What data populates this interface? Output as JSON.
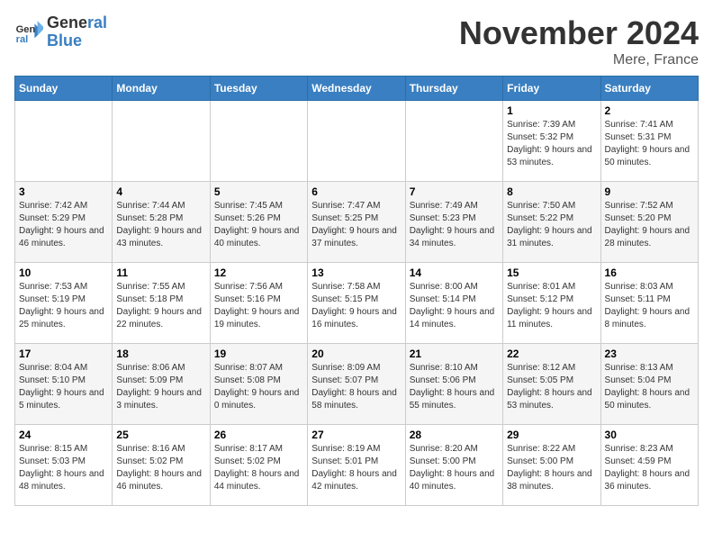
{
  "logo": {
    "line1": "General",
    "line2": "Blue"
  },
  "header": {
    "month": "November 2024",
    "location": "Mere, France"
  },
  "weekdays": [
    "Sunday",
    "Monday",
    "Tuesday",
    "Wednesday",
    "Thursday",
    "Friday",
    "Saturday"
  ],
  "weeks": [
    [
      {
        "day": "",
        "info": ""
      },
      {
        "day": "",
        "info": ""
      },
      {
        "day": "",
        "info": ""
      },
      {
        "day": "",
        "info": ""
      },
      {
        "day": "",
        "info": ""
      },
      {
        "day": "1",
        "info": "Sunrise: 7:39 AM\nSunset: 5:32 PM\nDaylight: 9 hours and 53 minutes."
      },
      {
        "day": "2",
        "info": "Sunrise: 7:41 AM\nSunset: 5:31 PM\nDaylight: 9 hours and 50 minutes."
      }
    ],
    [
      {
        "day": "3",
        "info": "Sunrise: 7:42 AM\nSunset: 5:29 PM\nDaylight: 9 hours and 46 minutes."
      },
      {
        "day": "4",
        "info": "Sunrise: 7:44 AM\nSunset: 5:28 PM\nDaylight: 9 hours and 43 minutes."
      },
      {
        "day": "5",
        "info": "Sunrise: 7:45 AM\nSunset: 5:26 PM\nDaylight: 9 hours and 40 minutes."
      },
      {
        "day": "6",
        "info": "Sunrise: 7:47 AM\nSunset: 5:25 PM\nDaylight: 9 hours and 37 minutes."
      },
      {
        "day": "7",
        "info": "Sunrise: 7:49 AM\nSunset: 5:23 PM\nDaylight: 9 hours and 34 minutes."
      },
      {
        "day": "8",
        "info": "Sunrise: 7:50 AM\nSunset: 5:22 PM\nDaylight: 9 hours and 31 minutes."
      },
      {
        "day": "9",
        "info": "Sunrise: 7:52 AM\nSunset: 5:20 PM\nDaylight: 9 hours and 28 minutes."
      }
    ],
    [
      {
        "day": "10",
        "info": "Sunrise: 7:53 AM\nSunset: 5:19 PM\nDaylight: 9 hours and 25 minutes."
      },
      {
        "day": "11",
        "info": "Sunrise: 7:55 AM\nSunset: 5:18 PM\nDaylight: 9 hours and 22 minutes."
      },
      {
        "day": "12",
        "info": "Sunrise: 7:56 AM\nSunset: 5:16 PM\nDaylight: 9 hours and 19 minutes."
      },
      {
        "day": "13",
        "info": "Sunrise: 7:58 AM\nSunset: 5:15 PM\nDaylight: 9 hours and 16 minutes."
      },
      {
        "day": "14",
        "info": "Sunrise: 8:00 AM\nSunset: 5:14 PM\nDaylight: 9 hours and 14 minutes."
      },
      {
        "day": "15",
        "info": "Sunrise: 8:01 AM\nSunset: 5:12 PM\nDaylight: 9 hours and 11 minutes."
      },
      {
        "day": "16",
        "info": "Sunrise: 8:03 AM\nSunset: 5:11 PM\nDaylight: 9 hours and 8 minutes."
      }
    ],
    [
      {
        "day": "17",
        "info": "Sunrise: 8:04 AM\nSunset: 5:10 PM\nDaylight: 9 hours and 5 minutes."
      },
      {
        "day": "18",
        "info": "Sunrise: 8:06 AM\nSunset: 5:09 PM\nDaylight: 9 hours and 3 minutes."
      },
      {
        "day": "19",
        "info": "Sunrise: 8:07 AM\nSunset: 5:08 PM\nDaylight: 9 hours and 0 minutes."
      },
      {
        "day": "20",
        "info": "Sunrise: 8:09 AM\nSunset: 5:07 PM\nDaylight: 8 hours and 58 minutes."
      },
      {
        "day": "21",
        "info": "Sunrise: 8:10 AM\nSunset: 5:06 PM\nDaylight: 8 hours and 55 minutes."
      },
      {
        "day": "22",
        "info": "Sunrise: 8:12 AM\nSunset: 5:05 PM\nDaylight: 8 hours and 53 minutes."
      },
      {
        "day": "23",
        "info": "Sunrise: 8:13 AM\nSunset: 5:04 PM\nDaylight: 8 hours and 50 minutes."
      }
    ],
    [
      {
        "day": "24",
        "info": "Sunrise: 8:15 AM\nSunset: 5:03 PM\nDaylight: 8 hours and 48 minutes."
      },
      {
        "day": "25",
        "info": "Sunrise: 8:16 AM\nSunset: 5:02 PM\nDaylight: 8 hours and 46 minutes."
      },
      {
        "day": "26",
        "info": "Sunrise: 8:17 AM\nSunset: 5:02 PM\nDaylight: 8 hours and 44 minutes."
      },
      {
        "day": "27",
        "info": "Sunrise: 8:19 AM\nSunset: 5:01 PM\nDaylight: 8 hours and 42 minutes."
      },
      {
        "day": "28",
        "info": "Sunrise: 8:20 AM\nSunset: 5:00 PM\nDaylight: 8 hours and 40 minutes."
      },
      {
        "day": "29",
        "info": "Sunrise: 8:22 AM\nSunset: 5:00 PM\nDaylight: 8 hours and 38 minutes."
      },
      {
        "day": "30",
        "info": "Sunrise: 8:23 AM\nSunset: 4:59 PM\nDaylight: 8 hours and 36 minutes."
      }
    ]
  ]
}
